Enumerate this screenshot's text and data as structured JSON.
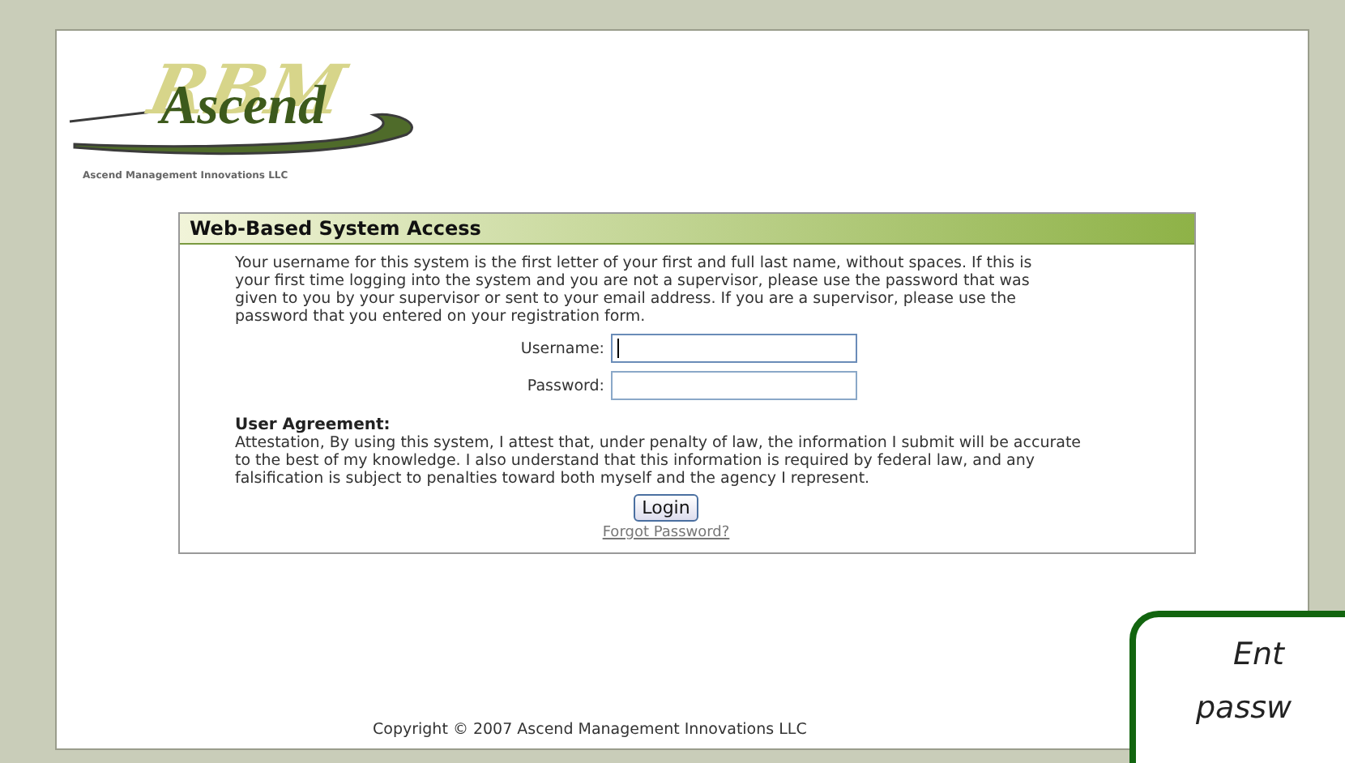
{
  "logo": {
    "back_text": "RBM",
    "front_text": "Ascend",
    "company": "Ascend Management Innovations LLC"
  },
  "panel": {
    "title": "Web-Based System Access",
    "intro": "Your username for this system is the first letter of your first and full last name, without spaces. If this is your first time logging into the system and you are not a supervisor, please use the password that was given to you by your supervisor or sent to your email address. If you are a supervisor, please use the password that you entered on your registration form.",
    "fields": [
      {
        "label": "Username:",
        "focused": true
      },
      {
        "label": "Password:",
        "focused": false
      }
    ],
    "agreement_title": "User Agreement:",
    "agreement_text": "Attestation, By using this system, I attest that, under penalty of law, the information I submit will be accurate to the best of my knowledge. I also understand that this information is required by federal law, and any falsification is subject to penalties toward both myself and the agency I represent.",
    "login_button": "Login",
    "forgot_link": "Forgot Password?"
  },
  "footer": "Copyright © 2007 Ascend Management Innovations LLC",
  "callout": {
    "lines": [
      "Ent",
      "passw"
    ]
  }
}
